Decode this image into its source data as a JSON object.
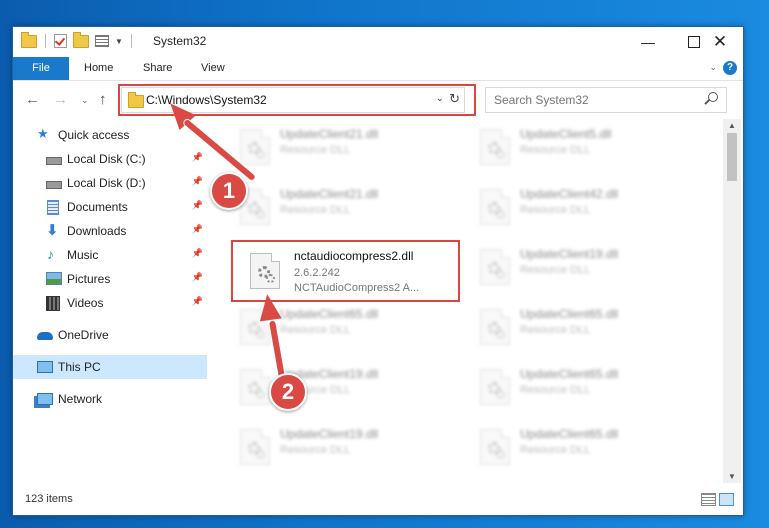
{
  "window": {
    "title": "System32"
  },
  "ribbon": {
    "tabs": [
      "File",
      "Home",
      "Share",
      "View"
    ],
    "help": "?"
  },
  "address": {
    "path": "C:\\Windows\\System32"
  },
  "search": {
    "placeholder": "Search System32"
  },
  "sidebar": {
    "items": [
      {
        "label": "Quick access",
        "icon": "star-icon"
      },
      {
        "label": "Local Disk (C:)",
        "icon": "drive-icon",
        "pinned": true
      },
      {
        "label": "Local Disk (D:)",
        "icon": "drive-icon",
        "pinned": true
      },
      {
        "label": "Documents",
        "icon": "documents-icon",
        "pinned": true
      },
      {
        "label": "Downloads",
        "icon": "downloads-icon",
        "pinned": true
      },
      {
        "label": "Music",
        "icon": "music-icon",
        "pinned": true
      },
      {
        "label": "Pictures",
        "icon": "pictures-icon",
        "pinned": true
      },
      {
        "label": "Videos",
        "icon": "videos-icon",
        "pinned": true
      },
      {
        "label": "OneDrive",
        "icon": "onedrive-icon"
      },
      {
        "label": "This PC",
        "icon": "this-pc-icon",
        "selected": true
      },
      {
        "label": "Network",
        "icon": "network-icon"
      }
    ]
  },
  "files": {
    "highlighted": {
      "name": "nctaudiocompress2.dll",
      "version": "2.6.2.242",
      "description": "NCTAudioCompress2 A..."
    },
    "left_column": [
      {
        "name": "UpdateClient21.dll",
        "type": "Resource DLL"
      },
      {
        "name": "UpdateClient21.dll",
        "type": "Resource DLL"
      },
      {
        "name": "UpdateClient65.dll",
        "type": "Resource DLL"
      },
      {
        "name": "UpdateClient19.dll",
        "type": "Resource DLL"
      },
      {
        "name": "UpdateClient19.dll",
        "type": "Resource DLL"
      }
    ],
    "right_column": [
      {
        "name": "UpdateClient5.dll",
        "type": "Resource DLL"
      },
      {
        "name": "UpdateClient42.dll",
        "type": "Resource DLL"
      },
      {
        "name": "UpdateClient19.dll",
        "type": "Resource DLL"
      },
      {
        "name": "UpdateClient65.dll",
        "type": "Resource DLL"
      },
      {
        "name": "UpdateClient65.dll",
        "type": "Resource DLL"
      },
      {
        "name": "UpdateClient65.dll",
        "type": "Resource DLL"
      }
    ]
  },
  "status": {
    "count": "123 items"
  },
  "annotations": {
    "step1": "1",
    "step2": "2"
  },
  "colors": {
    "accent": "#1979ca",
    "highlight": "#d9453f",
    "selection": "#cce8ff"
  }
}
